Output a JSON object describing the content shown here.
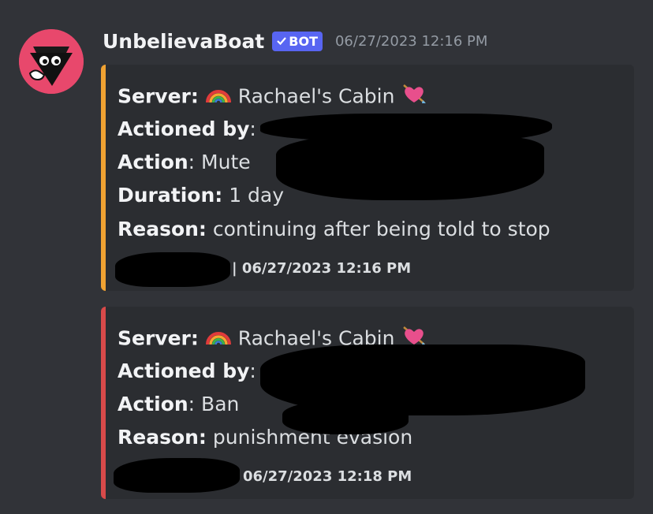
{
  "message": {
    "username": "UnbelievaBoat",
    "bot_badge": "BOT",
    "timestamp": "06/27/2023 12:16 PM"
  },
  "embeds": [
    {
      "accent": "#f0a232",
      "server_label": "Server:",
      "server_value": "Rachael's Cabin",
      "actioned_label": "Actioned by",
      "action_label": "Action",
      "action_value": "Mute",
      "duration_label": "Duration:",
      "duration_value": "1 day",
      "reason_label": "Reason:",
      "reason_value": "continuing after being told to stop",
      "footer": "| 06/27/2023 12:16 PM"
    },
    {
      "accent": "#d84a4a",
      "server_label": "Server:",
      "server_value": "Rachael's Cabin",
      "actioned_label": "Actioned by",
      "action_label": "Action",
      "action_value": "Ban",
      "reason_label": "Reason:",
      "reason_value": "punishment evasion",
      "footer": "06/27/2023 12:18 PM"
    }
  ],
  "icons": {
    "rainbow": "rainbow-emoji",
    "heart": "heart-with-arrow-emoji",
    "check": "check-icon"
  }
}
